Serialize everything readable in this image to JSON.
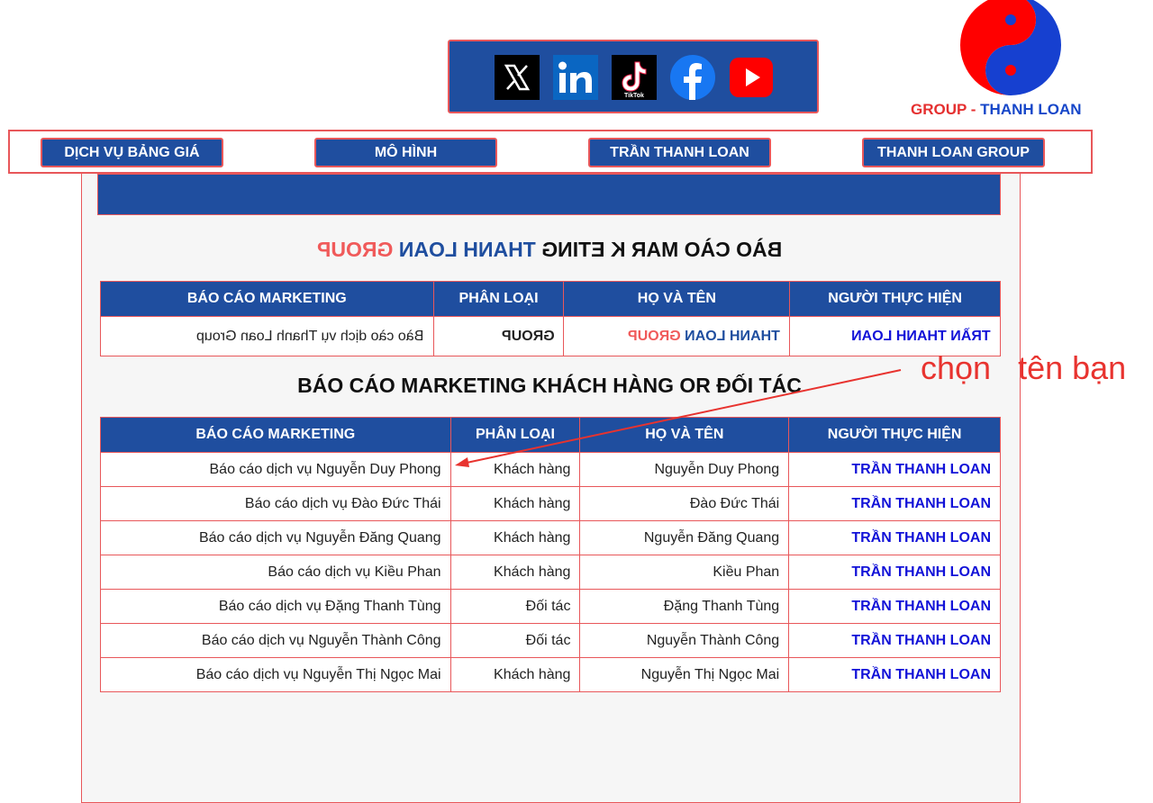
{
  "social": [
    {
      "name": "x-icon",
      "label": "X"
    },
    {
      "name": "linkedin-icon",
      "label": "in"
    },
    {
      "name": "tiktok-icon",
      "label": "TikTok"
    },
    {
      "name": "facebook-icon",
      "label": "f"
    },
    {
      "name": "youtube-icon",
      "label": "YouTube"
    }
  ],
  "logo": {
    "part1": "GROUP",
    "sep": " - ",
    "part2": "THANH LOAN"
  },
  "nav": [
    "DỊCH VỤ BẢNG GIÁ",
    "MÔ HÌNH",
    "TRẦN THANH LOAN",
    "THANH LOAN GROUP"
  ],
  "section1": {
    "title_a": "BÀO CÀO MAR K ETING ",
    "title_b": "THANH LOAN ",
    "title_c": "GROUP",
    "headers": [
      "BÁO CÁO MARKETING",
      "PHÂN LOẠI",
      "HỌ VÀ TÊN",
      "NGƯỜI THỰC HIỆN"
    ],
    "row": {
      "report": "Bào cào dịch vụ Thanh Loan Group",
      "type": "GROUP",
      "name_a": "THANH LOAN ",
      "name_b": "GROUP",
      "person": "TRẦN THANH LOAN"
    }
  },
  "section2": {
    "title": "BÁO CÁO MARKETING KHÁCH HÀNG OR ĐỐI TÁC",
    "headers": [
      "BÁO CÁO MARKETING",
      "PHÂN LOẠI",
      "HỌ VÀ TÊN",
      "NGƯỜI THỰC HIỆN"
    ],
    "rows": [
      {
        "report": "Báo cáo dịch vụ Nguyễn Duy Phong",
        "type": "Khách hàng",
        "name": "Nguyễn Duy Phong",
        "person": "TRẦN THANH LOAN"
      },
      {
        "report": "Báo cáo dịch vụ Đào Đức Thái",
        "type": "Khách hàng",
        "name": "Đào Đức Thái",
        "person": "TRẦN THANH LOAN"
      },
      {
        "report": "Báo cáo dịch vụ Nguyễn Đăng Quang",
        "type": "Khách hàng",
        "name": "Nguyễn Đăng Quang",
        "person": "TRẦN THANH LOAN"
      },
      {
        "report": "Báo cáo dịch vụ Kiều Phan",
        "type": "Khách hàng",
        "name": "Kiều Phan",
        "person": "TRẦN THANH LOAN"
      },
      {
        "report": "Báo cáo dịch vụ Đặng Thanh Tùng",
        "type": "Đối tác",
        "name": "Đặng Thanh Tùng",
        "person": "TRẦN THANH LOAN"
      },
      {
        "report": "Báo cáo dịch vụ Nguyễn Thành Công",
        "type": "Đối tác",
        "name": "Nguyễn Thành Công",
        "person": "TRẦN THANH LOAN"
      },
      {
        "report": "Báo cáo dịch vụ Nguyễn Thị Ngọc Mai",
        "type": "Khách hàng",
        "name": "Nguyễn Thị Ngọc Mai",
        "person": "TRẦN THANH LOAN"
      }
    ]
  },
  "annotation": "chọn   tên bạn",
  "colors": {
    "brand_blue": "#1f4e9f",
    "border_red": "#e8575a",
    "person_blue": "#1212d8",
    "note_red": "#e8332f"
  }
}
